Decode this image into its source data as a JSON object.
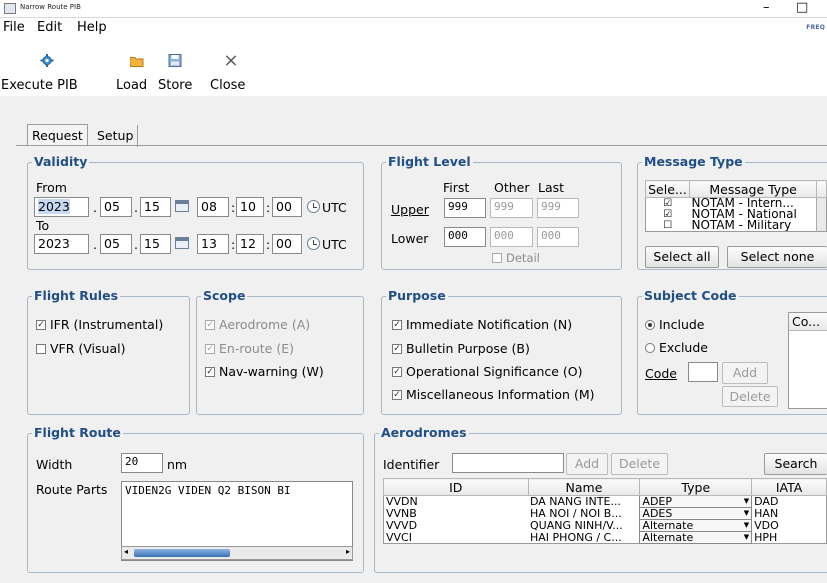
{
  "window": {
    "title": "Narrow Route PIB",
    "minimize": "–",
    "maximize": "□"
  },
  "menu": {
    "file": "File",
    "edit": "Edit",
    "help": "Help"
  },
  "brand": "FREQ",
  "toolbar": {
    "execute": "Execute PIB",
    "load": "Load",
    "store": "Store",
    "close": "Close"
  },
  "tabs": {
    "request": "Request",
    "setup": "Setup"
  },
  "validity": {
    "title": "Validity",
    "from_label": "From",
    "to_label": "To",
    "from": {
      "year": "2023",
      "month": "05",
      "day": "15",
      "hour": "08",
      "min": "10",
      "sec": "00"
    },
    "to": {
      "year": "2023",
      "month": "05",
      "day": "15",
      "hour": "13",
      "min": "12",
      "sec": "00"
    },
    "utc": "UTC"
  },
  "flight_level": {
    "title": "Flight Level",
    "col_first": "First",
    "col_other": "Other",
    "col_last": "Last",
    "upper_label": "Upper",
    "lower_label": "Lower",
    "upper": [
      "999",
      "999",
      "999"
    ],
    "lower": [
      "000",
      "000",
      "000"
    ],
    "detail": "Detail"
  },
  "message_type": {
    "title": "Message Type",
    "col_select": "Sele...",
    "col_type": "Message Type",
    "rows": [
      {
        "checked": "☑",
        "label": "NOTAM - Intern..."
      },
      {
        "checked": "☑",
        "label": "NOTAM - National"
      },
      {
        "checked": "☐",
        "label": "NOTAM - Military"
      }
    ],
    "select_all": "Select all",
    "select_none": "Select none"
  },
  "flight_rules": {
    "title": "Flight Rules",
    "ifr": "IFR (Instrumental)",
    "vfr": "VFR (Visual)"
  },
  "scope": {
    "title": "Scope",
    "aerodrome": "Aerodrome (A)",
    "enroute": "En-route (E)",
    "navwarning": "Nav-warning (W)"
  },
  "purpose": {
    "title": "Purpose",
    "immediate": "Immediate Notification (N)",
    "bulletin": "Bulletin Purpose (B)",
    "operational": "Operational Significance (O)",
    "misc": "Miscellaneous Information (M)"
  },
  "subject_code": {
    "title": "Subject Code",
    "include": "Include",
    "exclude": "Exclude",
    "code_label": "Code",
    "code_value": "",
    "add": "Add",
    "delete": "Delete",
    "col": "Co..."
  },
  "flight_route": {
    "title": "Flight Route",
    "width_label": "Width",
    "width_value": "20",
    "width_unit": "nm",
    "route_label": "Route Parts",
    "route_value": "VIDEN2G VIDEN Q2 BISON BI"
  },
  "aerodromes": {
    "title": "Aerodromes",
    "identifier_label": "Identifier",
    "identifier_value": "",
    "add": "Add",
    "delete": "Delete",
    "search": "Search",
    "columns": [
      "ID",
      "Name",
      "Type",
      "IATA"
    ],
    "rows": [
      {
        "id": "VVDN",
        "name": "DA NANG INTE...",
        "type": "ADEP",
        "iata": "DAD"
      },
      {
        "id": "VVNB",
        "name": "HA NOI / NOI B...",
        "type": "ADES",
        "iata": "HAN"
      },
      {
        "id": "VVVD",
        "name": "QUANG NINH/V...",
        "type": "Alternate",
        "iata": "VDO"
      },
      {
        "id": "VVCI",
        "name": "HAI PHONG / C...",
        "type": "Alternate",
        "iata": "HPH"
      }
    ]
  }
}
